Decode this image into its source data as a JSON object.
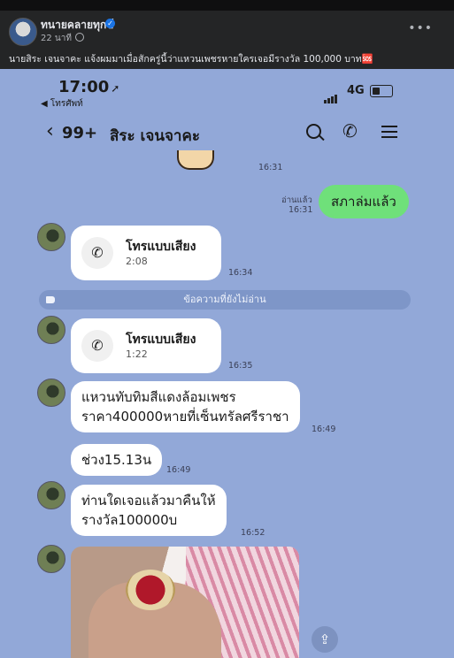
{
  "post": {
    "author": "ทนายคลายทุกข์",
    "time": "22 นาที",
    "caption": "นายสิระ เจนจาคะ แจ้งผมมาเมื่อสักครู่นี้ว่าแหวนเพชรหายใครเจอมีรางวัล 100,000 บาท🆘"
  },
  "screenshot": {
    "status_time": "17:00",
    "back_label": "◀ โทรศัพท์",
    "network": "4G",
    "unread_count": "99+",
    "contact_name": "สิระ เจนจาคะ",
    "sticker_time": "16:31",
    "read_label": "อ่านแล้ว",
    "out_time": "16:31",
    "out_message": "สภาล่มแล้ว",
    "call1": {
      "title": "โทรแบบเสียง",
      "duration": "2:08",
      "time": "16:34"
    },
    "unread_divider": "ข้อความที่ยังไม่อ่าน",
    "call2": {
      "title": "โทรแบบเสียง",
      "duration": "1:22",
      "time": "16:35"
    },
    "msg1": {
      "line1": "แหวนทับทิมสีแดงล้อมเพชร",
      "line2": "ราคา400000หายที่เซ็นทรัลศรีราชา",
      "time": "16:49"
    },
    "msg2": {
      "text": "ช่วง15.13น",
      "time": "16:49"
    },
    "msg3": {
      "line1": "ท่านใดเจอแล้วมาคืนให้",
      "line2": "รางวัล100000บ",
      "time": "16:52"
    }
  }
}
